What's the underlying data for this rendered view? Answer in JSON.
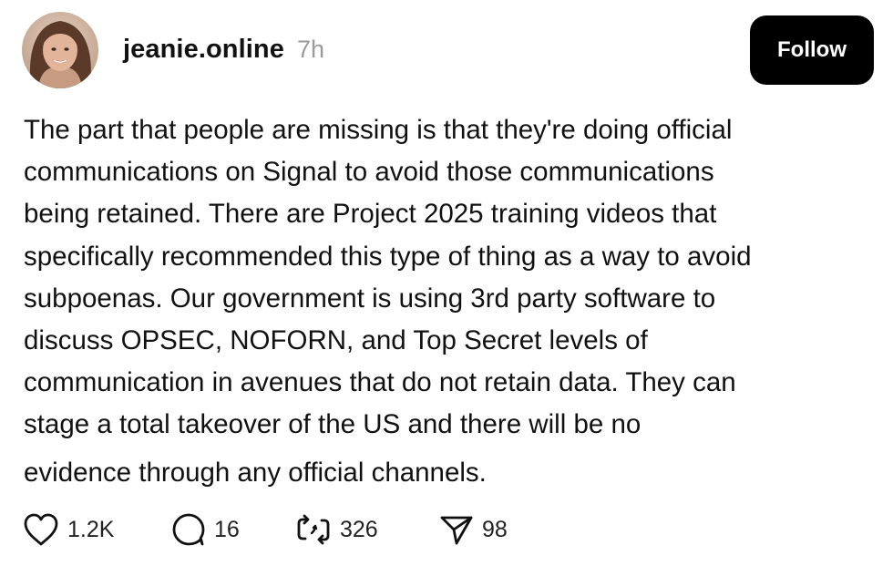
{
  "post": {
    "username": "jeanie.online",
    "time": "7h",
    "follow_label": "Follow",
    "body_lines": [
      "The part that people are missing is that they're doing official",
      "communications on Signal to avoid those communications",
      "being retained. There are Project 2025 training videos that",
      "specifically recommended this type of thing as a way to avoid",
      "subpoenas. Our government is using 3rd party software to",
      "discuss OPSEC, NOFORN, and Top Secret levels of",
      "communication in avenues that do not retain data. They can",
      "stage a total takeover of the US and there will be no",
      "evidence through any official channels."
    ],
    "actions": {
      "likes": "1.2K",
      "replies": "16",
      "reposts": "326",
      "shares": "98"
    },
    "icons": {
      "like": "heart-icon",
      "reply": "speech-bubble-icon",
      "repost": "repost-arrows-icon",
      "share": "paper-plane-icon"
    }
  }
}
